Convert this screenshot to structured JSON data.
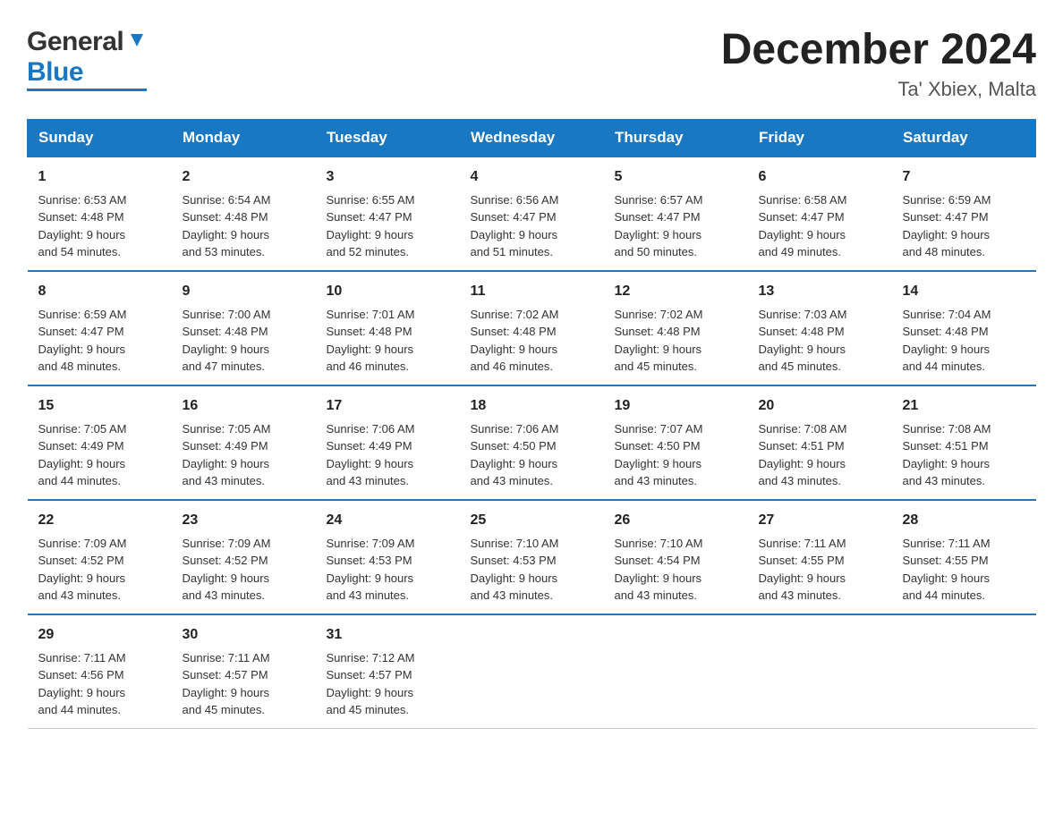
{
  "logo": {
    "general": "General",
    "blue": "Blue"
  },
  "title": {
    "month_year": "December 2024",
    "location": "Ta' Xbiex, Malta"
  },
  "days_of_week": [
    "Sunday",
    "Monday",
    "Tuesday",
    "Wednesday",
    "Thursday",
    "Friday",
    "Saturday"
  ],
  "weeks": [
    [
      {
        "day": "1",
        "sunrise": "6:53 AM",
        "sunset": "4:48 PM",
        "daylight": "9 hours and 54 minutes."
      },
      {
        "day": "2",
        "sunrise": "6:54 AM",
        "sunset": "4:48 PM",
        "daylight": "9 hours and 53 minutes."
      },
      {
        "day": "3",
        "sunrise": "6:55 AM",
        "sunset": "4:47 PM",
        "daylight": "9 hours and 52 minutes."
      },
      {
        "day": "4",
        "sunrise": "6:56 AM",
        "sunset": "4:47 PM",
        "daylight": "9 hours and 51 minutes."
      },
      {
        "day": "5",
        "sunrise": "6:57 AM",
        "sunset": "4:47 PM",
        "daylight": "9 hours and 50 minutes."
      },
      {
        "day": "6",
        "sunrise": "6:58 AM",
        "sunset": "4:47 PM",
        "daylight": "9 hours and 49 minutes."
      },
      {
        "day": "7",
        "sunrise": "6:59 AM",
        "sunset": "4:47 PM",
        "daylight": "9 hours and 48 minutes."
      }
    ],
    [
      {
        "day": "8",
        "sunrise": "6:59 AM",
        "sunset": "4:47 PM",
        "daylight": "9 hours and 48 minutes."
      },
      {
        "day": "9",
        "sunrise": "7:00 AM",
        "sunset": "4:48 PM",
        "daylight": "9 hours and 47 minutes."
      },
      {
        "day": "10",
        "sunrise": "7:01 AM",
        "sunset": "4:48 PM",
        "daylight": "9 hours and 46 minutes."
      },
      {
        "day": "11",
        "sunrise": "7:02 AM",
        "sunset": "4:48 PM",
        "daylight": "9 hours and 46 minutes."
      },
      {
        "day": "12",
        "sunrise": "7:02 AM",
        "sunset": "4:48 PM",
        "daylight": "9 hours and 45 minutes."
      },
      {
        "day": "13",
        "sunrise": "7:03 AM",
        "sunset": "4:48 PM",
        "daylight": "9 hours and 45 minutes."
      },
      {
        "day": "14",
        "sunrise": "7:04 AM",
        "sunset": "4:48 PM",
        "daylight": "9 hours and 44 minutes."
      }
    ],
    [
      {
        "day": "15",
        "sunrise": "7:05 AM",
        "sunset": "4:49 PM",
        "daylight": "9 hours and 44 minutes."
      },
      {
        "day": "16",
        "sunrise": "7:05 AM",
        "sunset": "4:49 PM",
        "daylight": "9 hours and 43 minutes."
      },
      {
        "day": "17",
        "sunrise": "7:06 AM",
        "sunset": "4:49 PM",
        "daylight": "9 hours and 43 minutes."
      },
      {
        "day": "18",
        "sunrise": "7:06 AM",
        "sunset": "4:50 PM",
        "daylight": "9 hours and 43 minutes."
      },
      {
        "day": "19",
        "sunrise": "7:07 AM",
        "sunset": "4:50 PM",
        "daylight": "9 hours and 43 minutes."
      },
      {
        "day": "20",
        "sunrise": "7:08 AM",
        "sunset": "4:51 PM",
        "daylight": "9 hours and 43 minutes."
      },
      {
        "day": "21",
        "sunrise": "7:08 AM",
        "sunset": "4:51 PM",
        "daylight": "9 hours and 43 minutes."
      }
    ],
    [
      {
        "day": "22",
        "sunrise": "7:09 AM",
        "sunset": "4:52 PM",
        "daylight": "9 hours and 43 minutes."
      },
      {
        "day": "23",
        "sunrise": "7:09 AM",
        "sunset": "4:52 PM",
        "daylight": "9 hours and 43 minutes."
      },
      {
        "day": "24",
        "sunrise": "7:09 AM",
        "sunset": "4:53 PM",
        "daylight": "9 hours and 43 minutes."
      },
      {
        "day": "25",
        "sunrise": "7:10 AM",
        "sunset": "4:53 PM",
        "daylight": "9 hours and 43 minutes."
      },
      {
        "day": "26",
        "sunrise": "7:10 AM",
        "sunset": "4:54 PM",
        "daylight": "9 hours and 43 minutes."
      },
      {
        "day": "27",
        "sunrise": "7:11 AM",
        "sunset": "4:55 PM",
        "daylight": "9 hours and 43 minutes."
      },
      {
        "day": "28",
        "sunrise": "7:11 AM",
        "sunset": "4:55 PM",
        "daylight": "9 hours and 44 minutes."
      }
    ],
    [
      {
        "day": "29",
        "sunrise": "7:11 AM",
        "sunset": "4:56 PM",
        "daylight": "9 hours and 44 minutes."
      },
      {
        "day": "30",
        "sunrise": "7:11 AM",
        "sunset": "4:57 PM",
        "daylight": "9 hours and 45 minutes."
      },
      {
        "day": "31",
        "sunrise": "7:12 AM",
        "sunset": "4:57 PM",
        "daylight": "9 hours and 45 minutes."
      },
      null,
      null,
      null,
      null
    ]
  ],
  "labels": {
    "sunrise": "Sunrise:",
    "sunset": "Sunset:",
    "daylight": "Daylight:"
  }
}
